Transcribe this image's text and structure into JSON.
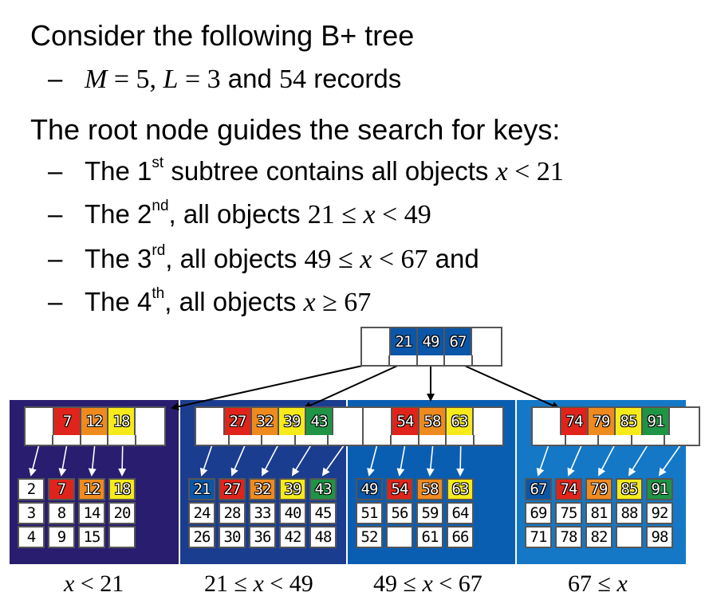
{
  "colors": {
    "red": "#e0241b",
    "orange": "#ef8a1e",
    "yellow": "#f6ea1a",
    "green": "#1f9444",
    "blue": "#0a56a8",
    "panel1": "#291d6f",
    "panel2": "#1b3d8f",
    "panel3": "#0a5eb2",
    "panel4": "#1478c7"
  },
  "bullet_dash": "–",
  "heading1": "Consider the following B+ tree",
  "sub1": {
    "m_var": "M",
    "m_eq": " = 5, ",
    "l_var": "L",
    "l_eq": " = 3",
    "and": " and ",
    "n": "54",
    "records": " records"
  },
  "heading2": "The root node guides the search for keys:",
  "bullets": [
    {
      "pre": "The 1",
      "sup": "st",
      "text": " subtree contains all objects ",
      "math_a": "x",
      "math_b": " < 21",
      "post": ""
    },
    {
      "pre": "The 2",
      "sup": "nd",
      "text": ", all objects ",
      "math_a": "21 ≤ ",
      "math_x": "x",
      "math_b": " < 49",
      "post": ""
    },
    {
      "pre": "The 3",
      "sup": "rd",
      "text": ", all objects ",
      "math_a": "49 ≤ ",
      "math_x": "x",
      "math_b": " < 67",
      "post": " and"
    },
    {
      "pre": "The 4",
      "sup": "th",
      "text": ", all objects ",
      "math_a": "x",
      "math_b": " ≥ 67",
      "post": ""
    }
  ],
  "root_keys": [
    "21",
    "49",
    "67"
  ],
  "panels": [
    {
      "internal": [
        {
          "k": "7",
          "c": "red"
        },
        {
          "k": "12",
          "c": "orange"
        },
        {
          "k": "18",
          "c": "yellow"
        }
      ],
      "leaves": [
        [
          "2",
          "3",
          "4"
        ],
        [
          "7",
          "8",
          "9"
        ],
        [
          "12",
          "14",
          "15"
        ],
        [
          "18",
          "20",
          ""
        ]
      ],
      "range_a": "x",
      "range_b": " < 21"
    },
    {
      "internal": [
        {
          "k": "27",
          "c": "red"
        },
        {
          "k": "32",
          "c": "orange"
        },
        {
          "k": "39",
          "c": "yellow"
        },
        {
          "k": "43",
          "c": "green"
        }
      ],
      "leaves": [
        [
          "21",
          "24",
          "26"
        ],
        [
          "27",
          "28",
          "30"
        ],
        [
          "32",
          "33",
          "36"
        ],
        [
          "39",
          "40",
          "42"
        ],
        [
          "43",
          "45",
          "48"
        ]
      ],
      "range_a": "21 ≤ ",
      "range_x": "x",
      "range_b": " < 49"
    },
    {
      "internal": [
        {
          "k": "54",
          "c": "red"
        },
        {
          "k": "58",
          "c": "orange"
        },
        {
          "k": "63",
          "c": "yellow"
        }
      ],
      "leaves": [
        [
          "49",
          "51",
          "52"
        ],
        [
          "54",
          "56",
          ""
        ],
        [
          "58",
          "59",
          "61"
        ],
        [
          "63",
          "64",
          "66"
        ]
      ],
      "range_a": "49 ≤ ",
      "range_x": "x",
      "range_b": " < 67"
    },
    {
      "internal": [
        {
          "k": "74",
          "c": "red"
        },
        {
          "k": "79",
          "c": "orange"
        },
        {
          "k": "85",
          "c": "yellow"
        },
        {
          "k": "91",
          "c": "green"
        }
      ],
      "leaves": [
        [
          "67",
          "69",
          "71"
        ],
        [
          "74",
          "75",
          "78"
        ],
        [
          "79",
          "81",
          "82"
        ],
        [
          "85",
          "88",
          ""
        ],
        [
          "91",
          "92",
          "98"
        ]
      ],
      "range_a": "67 ≤ ",
      "range_x": "x",
      "range_b": ""
    }
  ]
}
